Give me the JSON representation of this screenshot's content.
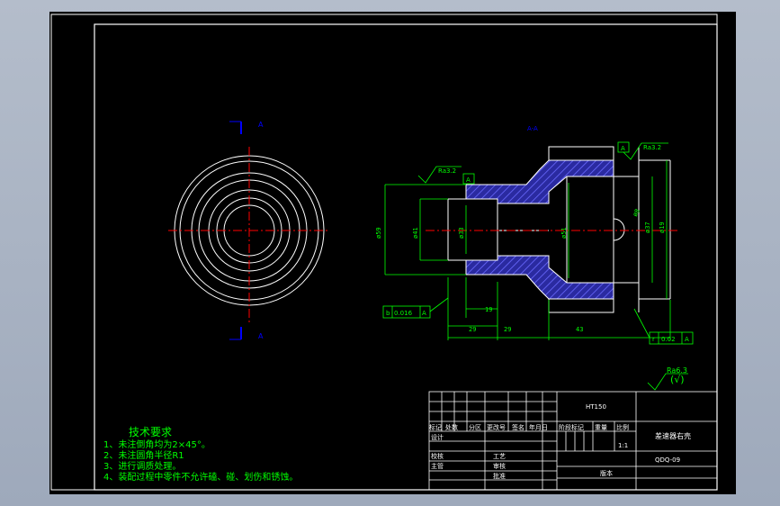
{
  "drawing": {
    "section_mark_top": "A",
    "section_mark_bottom": "A",
    "section_view_label": "A-A",
    "dims": {
      "d_outer": "ø59",
      "d_bore": "ø41",
      "d_neck": "ø33",
      "d_inner": "ø51",
      "d_right": "ø37",
      "d_flange": "ø19",
      "hole": "ø8",
      "len_19": "19",
      "len_29a": "29",
      "len_29b": "29",
      "len_43": "43"
    },
    "roughness": {
      "r1": "Ra3.2",
      "r2": "Ra3.2",
      "general": "Ra6.3",
      "general_note": "(√)"
    },
    "tolerances": {
      "t1_sym": "b",
      "t1_val": "0.016",
      "t1_ref": "A",
      "t2_sym": "r",
      "t2_val": "0.02",
      "t2_ref": "A",
      "datum": "A"
    }
  },
  "tech_req": {
    "title": "技术要求",
    "items": [
      "1、未注倒角均为2×45°。",
      "2、未注圆角半径R1",
      "3、进行调质处理。",
      "4、装配过程中零件不允许磕、碰、划伤和锈蚀。"
    ]
  },
  "title_block": {
    "material": "HT150",
    "part_name": "差速器右壳",
    "drawing_no": "QDQ-09",
    "scale": "1:1",
    "headers": [
      "标记",
      "处数",
      "分区",
      "更改号",
      "签名",
      "年月日"
    ],
    "stage_headers": [
      "阶段标记",
      "重量",
      "比例"
    ],
    "roles": [
      "设计",
      "校核",
      "主管"
    ],
    "roles2": [
      "工艺",
      "审核",
      "批准"
    ],
    "edition": "版本"
  },
  "colors": {
    "geometry": "#ffffff",
    "dimension": "#00ff00",
    "center": "#ff0000",
    "section_mark": "#0000ff",
    "hatch": "#3b3bd6",
    "text_green": "#00ff00",
    "roughness": "#ffffff"
  }
}
